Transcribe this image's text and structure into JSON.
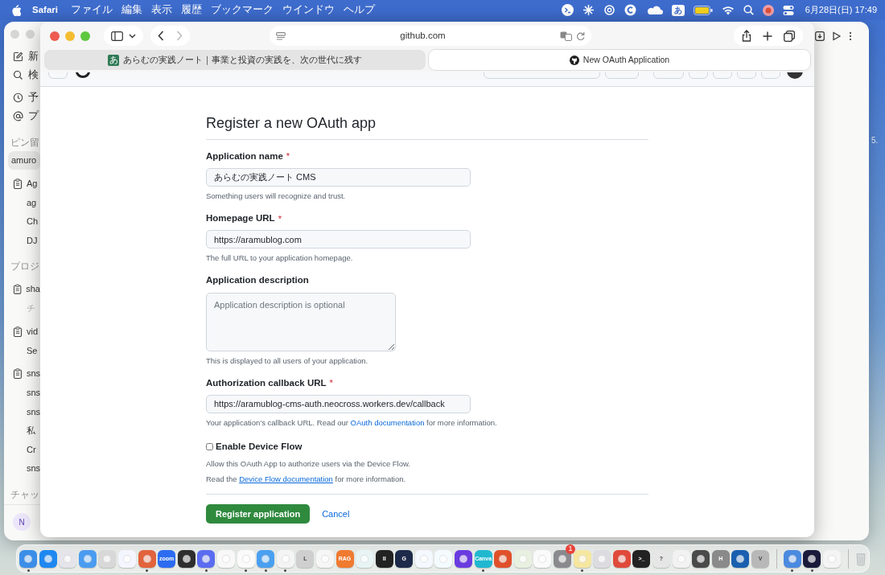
{
  "menu_bar": {
    "app": "Safari",
    "menus": [
      "ファイル",
      "編集",
      "表示",
      "履歴",
      "ブックマーク",
      "ウインドウ",
      "ヘルプ"
    ],
    "input_method": "あ",
    "clock": "6月28日(日) 17:49"
  },
  "background_window": {
    "sidebar": [
      {
        "kind": "action",
        "label": "新",
        "selected": false
      },
      {
        "kind": "action",
        "label": "検",
        "selected": false
      },
      {
        "kind": "action",
        "label": "予",
        "selected": false
      },
      {
        "kind": "action",
        "label": "プ",
        "selected": false
      },
      {
        "kind": "section",
        "label": "ピン留"
      },
      {
        "kind": "chat",
        "label": "amuro",
        "selected": true
      },
      {
        "kind": "project",
        "label": "Ag",
        "children": [
          {
            "label": "ag",
            "selected": false,
            "muted": false
          },
          {
            "label": "Ch",
            "selected": false,
            "muted": false
          },
          {
            "label": "DJ",
            "selected": false,
            "muted": false
          }
        ]
      },
      {
        "kind": "section",
        "label": "プロジ"
      },
      {
        "kind": "project",
        "label": "sha",
        "children": [
          {
            "label": "チ",
            "selected": false,
            "muted": true
          }
        ]
      },
      {
        "kind": "project",
        "label": "vid",
        "children": [
          {
            "label": "Se",
            "selected": false,
            "muted": false
          }
        ]
      },
      {
        "kind": "project",
        "label": "sns",
        "children": [
          {
            "label": "sns",
            "selected": false,
            "muted": false
          },
          {
            "label": "sns",
            "selected": false,
            "muted": false
          },
          {
            "label": "私",
            "selected": false,
            "muted": false
          },
          {
            "label": "Cr",
            "selected": false,
            "muted": false
          },
          {
            "label": "sns",
            "selected": false,
            "muted": false
          }
        ]
      },
      {
        "kind": "section",
        "label": "チャッ"
      },
      {
        "kind": "user",
        "label": "N"
      }
    ]
  },
  "desktop_text": "5.",
  "safari": {
    "address": "github.com",
    "tabs": [
      {
        "title": "あらむの実践ノート｜事業と投資の実践を、次の世代に残す",
        "favicon": "あ",
        "selected": false
      },
      {
        "title": "New OAuth Application",
        "selected": true
      }
    ],
    "form": {
      "title": "Register a new OAuth app",
      "fields": [
        {
          "kind": "input",
          "label": "Application name",
          "required": true,
          "value": "あらむの実践ノート CMS",
          "hint": "Something users will recognize and trust."
        },
        {
          "kind": "input",
          "label": "Homepage URL",
          "required": true,
          "value": "https://aramublog.com",
          "hint": "The full URL to your application homepage."
        },
        {
          "kind": "textarea",
          "label": "Application description",
          "required": false,
          "placeholder": "Application description is optional",
          "hint": "This is displayed to all users of your application."
        },
        {
          "kind": "input",
          "label": "Authorization callback URL",
          "required": true,
          "value": "https://aramublog-cms-auth.neocross.workers.dev/callback",
          "hint_before": "Your application’s callback URL. Read our",
          "hint_link": "OAuth documentation",
          "hint_after": "for more information."
        }
      ],
      "device_flow": {
        "label": "Enable Device Flow",
        "checked": false,
        "description": "Allow this OAuth App to authorize users via the Device Flow.",
        "read_before": "Read the",
        "read_link": "Device Flow documentation",
        "read_after": "for more information."
      },
      "required_mark": "*",
      "submit": "Register application",
      "cancel": "Cancel"
    }
  },
  "dock": {
    "apps": [
      {
        "color": "#3b8ee8",
        "running": true
      },
      {
        "color": "#1e88f0",
        "running": false
      },
      {
        "color": "#e4e4ea",
        "running": false
      },
      {
        "color": "#4a9cf0",
        "running": false
      },
      {
        "color": "#d8d8d8",
        "running": false
      },
      {
        "color": "#f4f6ff",
        "running": false
      },
      {
        "color": "#e2633c",
        "running": true
      },
      {
        "color": "#2d6cf0",
        "glyph": "zoom",
        "running": false
      },
      {
        "color": "#2e2e2e",
        "running": false
      },
      {
        "color": "#5a6cf0",
        "running": true
      },
      {
        "color": "#f8f8f8",
        "running": false
      },
      {
        "color": "#fafafa",
        "running": true
      },
      {
        "color": "#4aa0f0",
        "running": true
      },
      {
        "color": "#f4f4f4",
        "running": true
      },
      {
        "color": "#cfcfcf",
        "glyph": "L",
        "running": false
      },
      {
        "color": "#f6f6f6",
        "running": false
      },
      {
        "color": "#f07a30",
        "glyph": "RAG",
        "running": false
      },
      {
        "color": "#e8f4f4",
        "running": false
      },
      {
        "color": "#222222",
        "glyph": "II",
        "running": false
      },
      {
        "color": "#1e2a4a",
        "glyph": "G",
        "running": false
      },
      {
        "color": "#f4f8ff",
        "running": false
      },
      {
        "color": "#f4fbff",
        "running": false
      },
      {
        "color": "#6a3ce0",
        "running": false
      },
      {
        "color": "#20b8d0",
        "glyph": "Canva",
        "running": true
      },
      {
        "color": "#e0502a",
        "running": false
      },
      {
        "color": "#e8f0e0",
        "running": false
      },
      {
        "color": "#fafafa",
        "running": false
      },
      {
        "color": "#8a8a8e",
        "badge": "1",
        "running": false
      },
      {
        "color": "#f6e7a0",
        "running": true
      },
      {
        "color": "#dcdce0",
        "running": false
      },
      {
        "color": "#e04a3a",
        "running": false
      },
      {
        "color": "#222222",
        "glyph": ">_",
        "running": false
      },
      {
        "color": "#e6e6e6",
        "glyph": "?",
        "running": false
      },
      {
        "color": "#f2f2f2",
        "running": false
      },
      {
        "color": "#4a4a4a",
        "running": false
      },
      {
        "color": "#8a8a8a",
        "glyph": "H",
        "running": false
      },
      {
        "color": "#1a5fb0",
        "running": false
      },
      {
        "color": "#b8b8b8",
        "glyph": "V",
        "running": false
      },
      {
        "color": "#4a8ae0",
        "running": true
      },
      {
        "color": "#1a1a3a",
        "running": true
      },
      {
        "color": "#f4f4f4",
        "running": false
      }
    ]
  }
}
